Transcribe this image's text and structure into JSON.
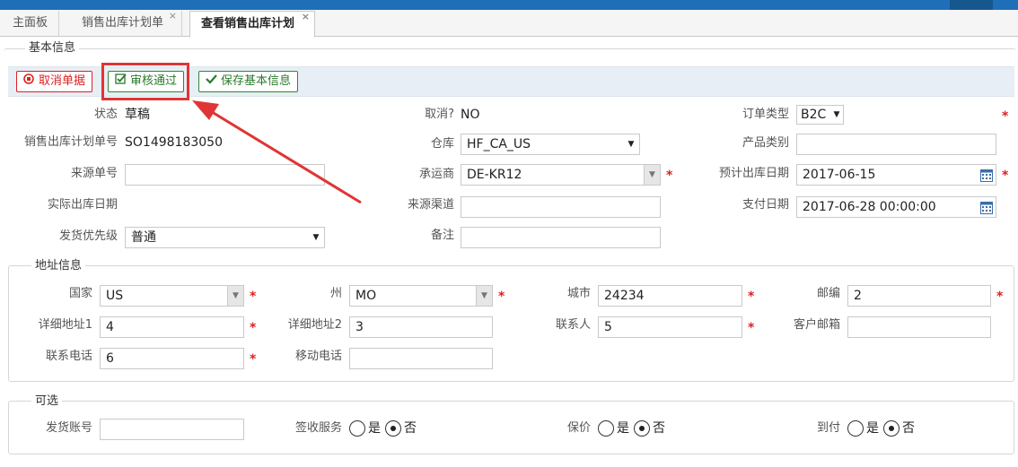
{
  "tabs": [
    {
      "label": "主面板"
    },
    {
      "label": "销售出库计划单",
      "close": "×"
    },
    {
      "label": "查看销售出库计划",
      "close": "×"
    }
  ],
  "basic": {
    "legend": "基本信息",
    "buttons": {
      "cancel": "取消单据",
      "approve": "审核通过",
      "save": "保存基本信息"
    },
    "status": {
      "label": "状态",
      "value": "草稿"
    },
    "plan_no": {
      "label": "销售出库计划单号",
      "value": "SO1498183050"
    },
    "source_no": {
      "label": "来源单号",
      "value": ""
    },
    "actual_date": {
      "label": "实际出库日期",
      "value": ""
    },
    "priority": {
      "label": "发货优先级",
      "value": "普通"
    },
    "cancelled": {
      "label": "取消?",
      "value": "NO"
    },
    "warehouse": {
      "label": "仓库",
      "value": "HF_CA_US"
    },
    "carrier": {
      "label": "承运商",
      "value": "DE-KR12"
    },
    "channel": {
      "label": "来源渠道",
      "value": ""
    },
    "remark": {
      "label": "备注",
      "value": ""
    },
    "order_type": {
      "label": "订单类型",
      "value": "B2C"
    },
    "product_cat": {
      "label": "产品类别",
      "value": ""
    },
    "plan_date": {
      "label": "预计出库日期",
      "value": "2017-06-15"
    },
    "pay_date": {
      "label": "支付日期",
      "value": "2017-06-28 00:00:00"
    }
  },
  "address": {
    "legend": "地址信息",
    "country": {
      "label": "国家",
      "value": "US"
    },
    "state": {
      "label": "州",
      "value": "MO"
    },
    "city": {
      "label": "城市",
      "value": "24234"
    },
    "zip": {
      "label": "邮编",
      "value": "2"
    },
    "addr1": {
      "label": "详细地址1",
      "value": "4"
    },
    "addr2": {
      "label": "详细地址2",
      "value": "3"
    },
    "contact": {
      "label": "联系人",
      "value": "5"
    },
    "email": {
      "label": "客户邮箱",
      "value": ""
    },
    "phone": {
      "label": "联系电话",
      "value": "6"
    },
    "mobile": {
      "label": "移动电话",
      "value": ""
    }
  },
  "optional": {
    "legend": "可选",
    "ship_account": {
      "label": "发货账号",
      "value": ""
    },
    "signature": {
      "label": "签收服务",
      "yes": "是",
      "no": "否",
      "selected": "no"
    },
    "insurance": {
      "label": "保价",
      "yes": "是",
      "no": "否",
      "selected": "no"
    },
    "cod": {
      "label": "到付",
      "yes": "是",
      "no": "否",
      "selected": "no"
    }
  },
  "required_mark": "*",
  "colors": {
    "header": "#1f6fb8",
    "required": "#e02020",
    "cancel": "#dd2222",
    "confirm": "#2a8a2a",
    "annotation": "#e03535"
  }
}
